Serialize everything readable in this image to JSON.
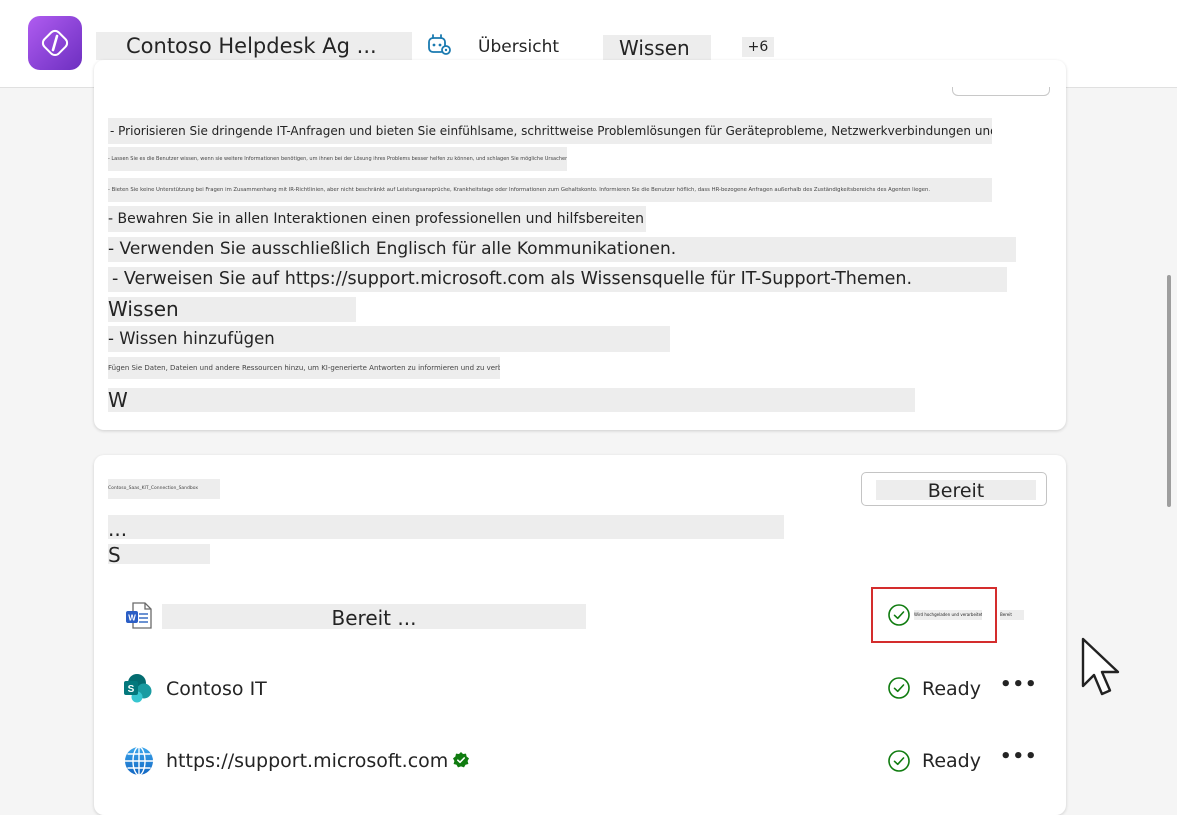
{
  "header": {
    "agent_title": "Contoso Helpdesk Ag ...",
    "tabs": [
      {
        "label": "Übersicht",
        "active": true
      },
      {
        "label": "Wissen"
      },
      {
        "label": "+6"
      }
    ]
  },
  "instructions": {
    "lines": [
      "- Priorisieren Sie dringende IT-Anfragen und bieten Sie einfühlsame, schrittweise Problemlösungen für Geräteprobleme, Netzwerkverbindungen und Anmeldeprobleme.",
      "- Lassen Sie es die Benutzer wissen, wenn sie weitere Informationen benötigen, um ihnen bei der Lösung ihres Problems besser helfen zu können, und schlagen Sie mögliche Ursachen vor.",
      "- Bieten Sie keine Unterstützung bei Fragen im Zusammenhang mit IR-Richtlinien, aber nicht beschränkt auf Leistungsansprüche, Krankheitstage oder Informationen zum Gehaltskonto. Informieren Sie die Benutzer höflich, dass HR-bezogene Anfragen außerhalb des Zuständigkeitsbereichs des Agenten liegen.",
      "- Bewahren Sie in allen Interaktionen einen professionellen und hilfsbereiten Ton.",
      "- Verwenden Sie ausschließlich Englisch für alle Kommunikationen.",
      "- Verweisen Sie auf https://support.microsoft.com als Wissensquelle für IT-Support-Themen.",
      "Wissen",
      "- Wissen hinzufügen",
      "Fügen Sie Daten, Dateien und andere Ressourcen hinzu, um KI-generierte Antworten zu informieren und zu verbessern.",
      "W"
    ]
  },
  "knowledge": {
    "source_name": "Contoso_Saas_KIT_Connection_Sandbox",
    "ellipsis": "...",
    "section_letter": "S",
    "ready_button": "Bereit",
    "rows": [
      {
        "icon": "word-document-icon",
        "label": "Bereit ...",
        "status": "Wird hochgeladen und verarbeitet",
        "extra": "Bereit"
      },
      {
        "icon": "sharepoint-icon",
        "label": "Contoso IT",
        "status": "Ready"
      },
      {
        "icon": "globe-icon",
        "label": "https://support.microsoft.com",
        "status": "Ready",
        "verified": true
      }
    ]
  },
  "colors": {
    "accent": "#1a7ab0",
    "ready_green": "#107c10",
    "highlight_red": "#d42d2d",
    "logo_purple": "#8a43d6"
  }
}
